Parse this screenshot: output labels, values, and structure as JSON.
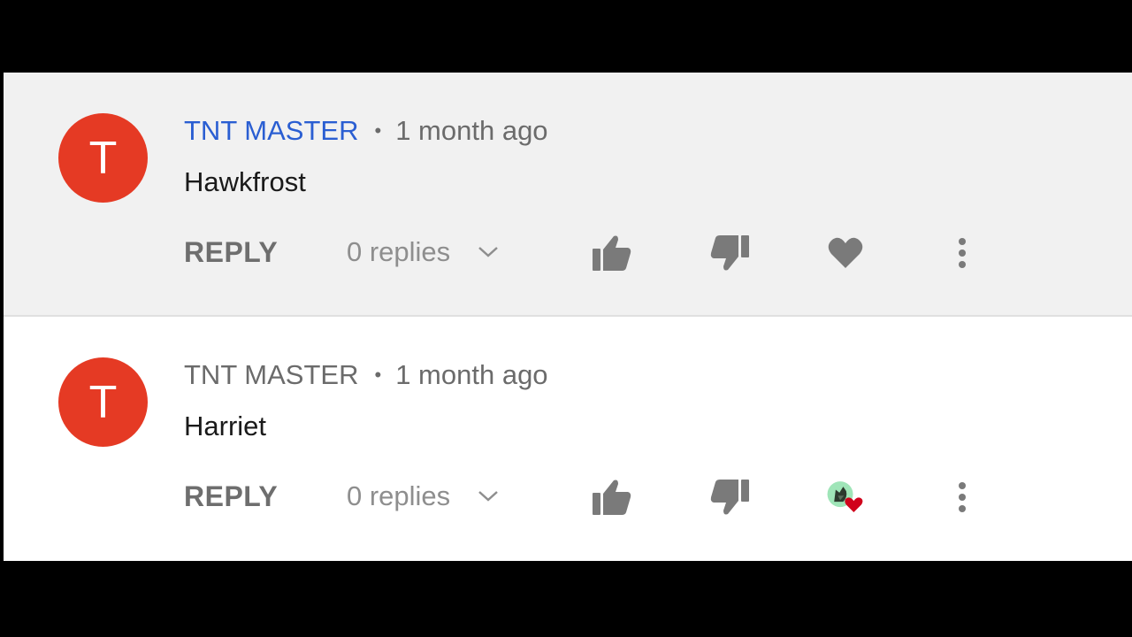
{
  "comments": [
    {
      "author": "TNT MASTER",
      "author_highlighted": true,
      "separator": "•",
      "time": "1 month ago",
      "text": "Hawkfrost",
      "avatar_letter": "T",
      "reply_label": "REPLY",
      "replies_label": "0 replies",
      "heart_state": "unhearted",
      "icons": [
        "thumbs-up-icon",
        "thumbs-down-icon",
        "heart-icon",
        "more-vert-icon"
      ]
    },
    {
      "author": "TNT MASTER",
      "author_highlighted": false,
      "separator": "•",
      "time": "1 month ago",
      "text": "Harriet",
      "avatar_letter": "T",
      "reply_label": "REPLY",
      "replies_label": "0 replies",
      "heart_state": "hearted-by-creator",
      "icons": [
        "thumbs-up-icon",
        "thumbs-down-icon",
        "creator-heart-icon",
        "more-vert-icon"
      ]
    }
  ],
  "colors": {
    "avatar": "#e53a24",
    "author_link": "#2a5ed2",
    "highlight_bg": "#f1f1f1",
    "heart_red": "#d0021b",
    "icon_gray": "#7a7a7a"
  }
}
